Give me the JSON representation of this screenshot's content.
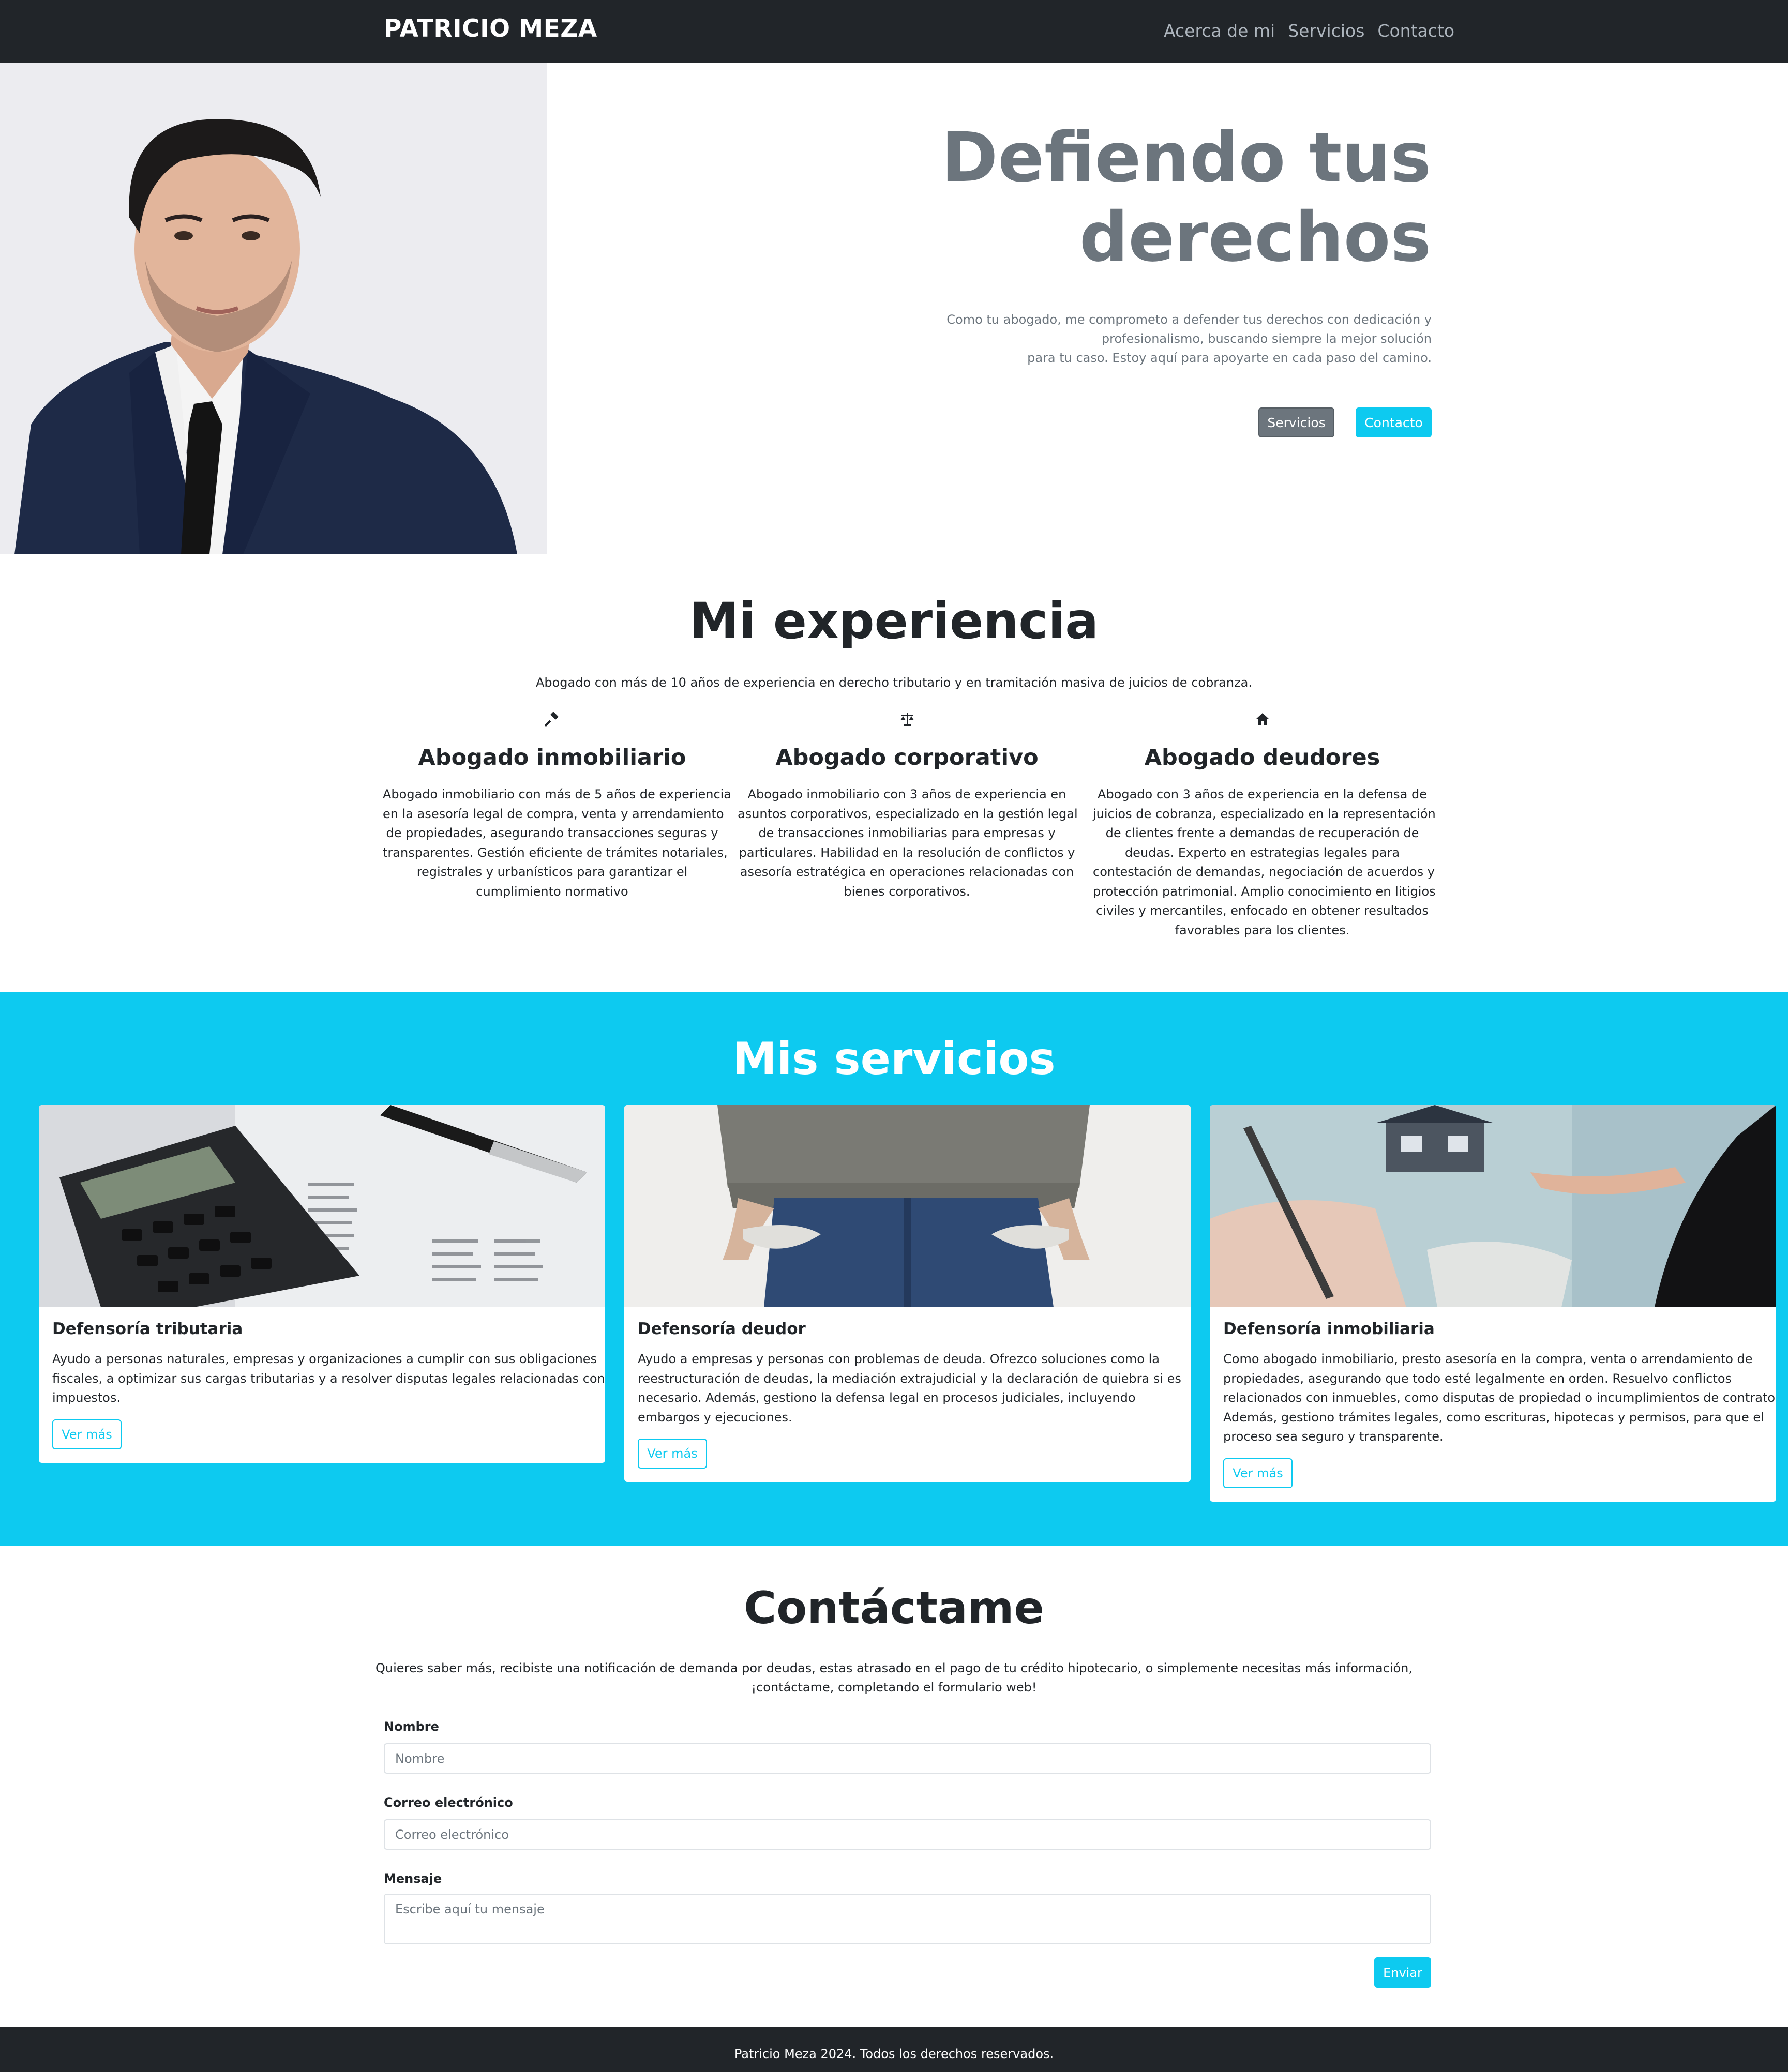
{
  "navbar": {
    "brand": "PATRICIO MEZA",
    "links": [
      "Acerca de mi",
      "Servicios",
      "Contacto"
    ]
  },
  "hero": {
    "title_line1": "Defiendo tus",
    "title_line2": "derechos",
    "text_lines": [
      "Como tu abogado, me comprometo a defender tus derechos con dedicación y",
      "profesionalismo, buscando siempre la mejor solución",
      "para tu caso. Estoy aquí para apoyarte en cada paso del camino."
    ],
    "btn_services": "Servicios",
    "btn_contact": "Contacto"
  },
  "experience": {
    "title": "Mi experiencia",
    "subtitle": "Abogado con más de 10 años de experiencia en derecho tributario y en tramitación masiva de juicios de cobranza.",
    "items": [
      {
        "icon": "gavel-icon",
        "title": "Abogado inmobiliario",
        "lines": [
          "Abogado inmobiliario con más de 5 años de experiencia",
          "en la asesoría legal de compra, venta y arrendamiento",
          "de propiedades, asegurando transacciones seguras y",
          "transparentes. Gestión eficiente de trámites notariales,",
          "registrales y urbanísticos para garantizar el",
          "cumplimiento normativo"
        ]
      },
      {
        "icon": "scale-icon",
        "title": "Abogado corporativo",
        "lines": [
          "Abogado inmobiliario con 3 años de experiencia en",
          "asuntos corporativos, especializado en la gestión legal",
          "de transacciones inmobiliarias para empresas y",
          "particulares. Habilidad en la resolución de conflictos y",
          "asesoría estratégica en operaciones relacionadas con",
          "bienes corporativos."
        ]
      },
      {
        "icon": "house-icon",
        "title": "Abogado deudores",
        "lines": [
          "Abogado con 3 años de experiencia en la defensa de",
          "juicios de cobranza, especializado en la representación",
          "de clientes frente a demandas de recuperación de",
          "deudas. Experto en estrategias legales para",
          "contestación de demandas, negociación de acuerdos y",
          "protección patrimonial. Amplio conocimiento en litigios",
          "civiles y mercantiles, enfocado en obtener resultados",
          "favorables para los clientes."
        ]
      }
    ]
  },
  "services": {
    "title": "Mis servicios",
    "cards": [
      {
        "title": "Defensoría tributaria",
        "lines": [
          "Ayudo a personas naturales, empresas y organizaciones a cumplir con sus obligaciones",
          "fiscales, a optimizar sus cargas tributarias y a resolver disputas legales relacionadas con",
          "impuestos."
        ],
        "button": "Ver más"
      },
      {
        "title": "Defensoría deudor",
        "lines": [
          "Ayudo a empresas y personas con problemas de deuda. Ofrezco soluciones como la",
          "reestructuración de deudas, la mediación extrajudicial y la declaración de quiebra si es",
          "necesario. Además, gestiono la defensa legal en procesos judiciales, incluyendo",
          "embargos y ejecuciones."
        ],
        "button": "Ver más"
      },
      {
        "title": "Defensoría inmobiliaria",
        "lines": [
          "Como abogado inmobiliario, presto asesoría en la compra, venta o arrendamiento de",
          "propiedades, asegurando que todo esté legalmente en orden. Resuelvo conflictos",
          "relacionados con inmuebles, como disputas de propiedad o incumplimientos de contrato.",
          "Además, gestiono trámites legales, como escrituras, hipotecas y permisos, para que el",
          "proceso sea seguro y transparente."
        ],
        "button": "Ver más"
      }
    ]
  },
  "contact": {
    "title": "Contáctame",
    "intro_lines": [
      "Quieres saber más, recibiste una notificación de demanda por deudas, estas atrasado en el pago de tu crédito hipotecario, o simplemente necesitas más información,",
      "¡contáctame, completando el formulario web!"
    ],
    "name_label": "Nombre",
    "name_placeholder": "Nombre",
    "email_label": "Correo electrónico",
    "email_placeholder": "Correo electrónico",
    "message_label": "Mensaje",
    "message_placeholder": "Escribe aquí tu mensaje",
    "submit": "Enviar"
  },
  "footer": {
    "text": "Patricio Meza 2024. Todos los derechos reservados."
  },
  "colors": {
    "dark": "#212529",
    "accent": "#0dcaf0",
    "secondary": "#6c757d"
  }
}
